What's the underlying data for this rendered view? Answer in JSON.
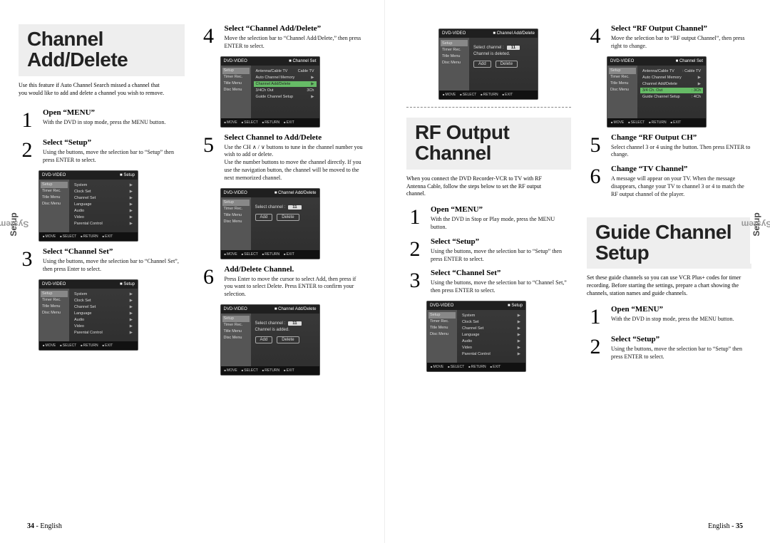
{
  "left_page": {
    "section1": "Channel Add/Delete",
    "intro": "Use this feature if Auto Channel Search missed a channel that you would like to add and delete a channel you wish to remove.",
    "sidetab_light": "System",
    "sidetab_bold": "Setup",
    "steps_colA": [
      {
        "n": "1",
        "title": "Open “MENU”",
        "text": "With the DVD in stop mode, press the MENU button."
      },
      {
        "n": "2",
        "title": "Select “Setup”",
        "text": "Using the           buttons, move the selection bar to “Setup” then press ENTER to select."
      },
      {
        "n": "3",
        "title": "Select “Channel Set”",
        "text": "Using the           buttons, move the selection bar to “Channel Set”, then press Enter to select."
      }
    ],
    "steps_colB": [
      {
        "n": "4",
        "title": "Select “Channel Add/Delete”",
        "text": "Move the selection bar to “Channel Add/Delete,” then press ENTER to select."
      },
      {
        "n": "5",
        "title": "Select Channel to Add/Delete",
        "text": "Use the CH  ∧ / ∨  buttons to tune in the channel number you wish to add or delete.\nUse the number buttons to move the channel directly. If you use the navigation           button, the channel will be moved to the next memorized channel."
      },
      {
        "n": "6",
        "title": "Add/Delete Channel.",
        "text": "Press Enter to move the cursor to select Add, then press        if you want to select Delete. Press ENTER to confirm your selection."
      }
    ],
    "footer_num": "34",
    "footer_lang": "English"
  },
  "right_page": {
    "section2": "RF Output Channel",
    "intro2": "When you connect the DVD Recorder-VCR to TV with RF Antenna Cable, follow the steps below to set the RF output channel.",
    "section3": "Guide Channel Setup",
    "intro3": "Set these guide channels so you can use VCR Plus+ codes for timer recording. Before starting the settings, prepare a chart showing the channels, station names and guide channels.",
    "sidetab_light": "System",
    "sidetab_bold": "Setup",
    "rf_steps_colA": [
      {
        "n": "1",
        "title": "Open “MENU”",
        "text": "With the DVD in Stop or Play mode, press the MENU button."
      },
      {
        "n": "2",
        "title": "Select “Setup”",
        "text": "Using the           buttons, move the selection bar to “Setup” then press ENTER to select."
      },
      {
        "n": "3",
        "title": "Select “Channel Set”",
        "text": "Using the           buttons, move the selection bar to “Channel Set,” then press ENTER to select."
      }
    ],
    "rf_steps_colB": [
      {
        "n": "4",
        "title": "Select “RF Output Channel”",
        "text": "Move the selection bar to “RF output Channel”, then press right to change."
      },
      {
        "n": "5",
        "title": "Change “RF Output CH”",
        "text": "Select channel 3 or 4 using the           button. Then press ENTER to change."
      },
      {
        "n": "6",
        "title": "Change “TV Channel”",
        "text": "A message will appear on your TV. When the message disappears, change your TV to channel 3 or 4 to match the RF output channel of the player."
      }
    ],
    "guide_steps": [
      {
        "n": "1",
        "title": "Open “MENU”",
        "text": "With the DVD in stop mode, press the MENU button."
      },
      {
        "n": "2",
        "title": "Select “Setup”",
        "text": "Using the           buttons, move the selection bar to “Setup” then press ENTER to select."
      }
    ],
    "footer_lang": "English",
    "footer_num": "35"
  },
  "osd": {
    "header_left": "DVD-VIDEO",
    "header_setup": "Setup",
    "header_chset": "Channel Set",
    "header_chadd": "Channel Add/Delete",
    "side": [
      "Setup",
      "Timer Rec.",
      "Title Menu",
      "Disc Menu"
    ],
    "setup_items": [
      "System",
      "Clock Set",
      "Channel Set",
      "Language",
      "Audio",
      "Video",
      "Parental Control"
    ],
    "chset_items": [
      "Antenna/Cable TV",
      "Auto Channel Memory",
      "Channel Add/Delete",
      "3/4Ch Out",
      "Guide Channel Setup"
    ],
    "chset_vals": [
      "Cable TV",
      "",
      "",
      "3Ch",
      ""
    ],
    "chset_items_rf": [
      "Antenna/Cable TV",
      "Auto Channel Memory",
      "Channel Add/Delete",
      "3/4 Ch. Out",
      "Guide Channel Setup"
    ],
    "chset_vals_rf": [
      ": Cable TV",
      "",
      "",
      ": 3Ch",
      ": 4Ch"
    ],
    "select_channel": "Select channel :",
    "ch_num": "11",
    "deleted": "Channel is deleted.",
    "added": "Channel is added.",
    "btn_add": "Add",
    "btn_del": "Delete",
    "bbar": [
      "MOVE",
      "SELECT",
      "RETURN",
      "EXIT"
    ]
  }
}
